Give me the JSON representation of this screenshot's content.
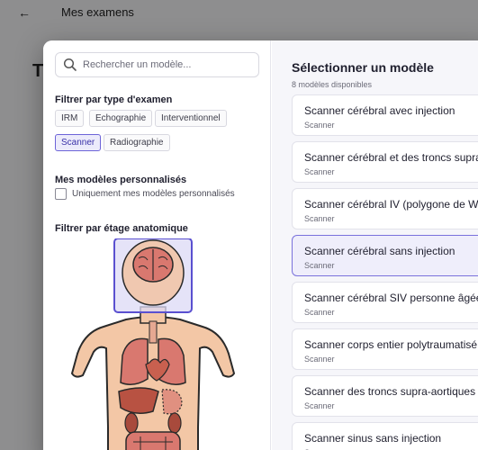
{
  "background": {
    "back_arrow": "←",
    "page_title": "Mes examens",
    "partial_heading": "T"
  },
  "search": {
    "placeholder": "Rechercher un modèle...",
    "icon": "search-icon"
  },
  "filters": {
    "exam_type_title": "Filtrer par type d'examen",
    "exam_types": [
      {
        "label": "IRM",
        "active": false
      },
      {
        "label": "Echographie",
        "active": false
      },
      {
        "label": "Interventionnel",
        "active": false
      },
      {
        "label": "Scanner",
        "active": true
      },
      {
        "label": "Radiographie",
        "active": false
      }
    ],
    "custom_title": "Mes modèles personnalisés",
    "custom_checkbox_label": "Uniquement mes modèles personnalisés",
    "custom_checked": false,
    "anatomy_title": "Filtrer par étage anatomique",
    "anatomy_selected_region": "head"
  },
  "models": {
    "title": "Sélectionner un modèle",
    "count": "8 modèles disponibles",
    "items": [
      {
        "name": "Scanner cérébral avec injection",
        "type": "Scanner",
        "selected": false
      },
      {
        "name": "Scanner cérébral et des troncs supra-aortiques",
        "type": "Scanner",
        "selected": false
      },
      {
        "name": "Scanner cérébral IV (polygone de Willis)",
        "type": "Scanner",
        "selected": false
      },
      {
        "name": "Scanner cérébral sans injection",
        "type": "Scanner",
        "selected": true
      },
      {
        "name": "Scanner cérébral SIV personne âgée",
        "type": "Scanner",
        "selected": false
      },
      {
        "name": "Scanner corps entier polytraumatisé",
        "type": "Scanner",
        "selected": false
      },
      {
        "name": "Scanner des troncs supra-aortiques",
        "type": "Scanner",
        "selected": false
      },
      {
        "name": "Scanner sinus sans injection",
        "type": "Scanner",
        "selected": false
      }
    ]
  },
  "colors": {
    "accent": "#6d64d8",
    "skin": "#f3c7a6",
    "brain": "#d9786f",
    "organs": "#c9604f"
  }
}
